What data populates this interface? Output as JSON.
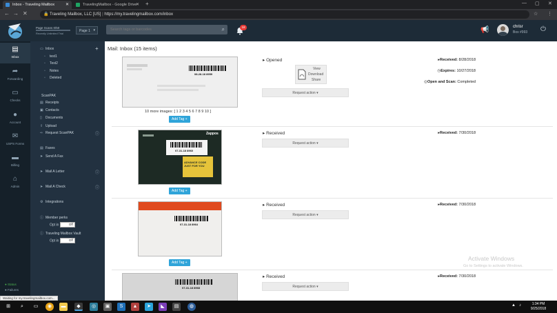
{
  "browser": {
    "tabs": [
      {
        "title": "Inbox - Traveling Mailbox",
        "color": "#3b8bd6"
      },
      {
        "title": "TravelingMailbox - Google Drive",
        "color": "#1ea362"
      }
    ],
    "url_owner": "Traveling Mailbox, LLC [US]",
    "url": "https://my.travelingmailbox.com/inbox",
    "status_bar": "Waiting for my.travelingmailbox.com..."
  },
  "header": {
    "scans_label": "Page Scans",
    "scans_value": "0/50",
    "plan_label": "Recently Unlimited Trial",
    "page_select": "Page 1",
    "search_placeholder": "Search tags or barcodes",
    "notification_count": "18",
    "user_name": "chrisr",
    "user_box": "Box #993"
  },
  "leftnav": [
    {
      "label": "Inbox",
      "icon": "inbox-icon",
      "glyph": "▤"
    },
    {
      "label": "Forwarding",
      "icon": "forward-icon",
      "glyph": "➦"
    },
    {
      "label": "Checks",
      "icon": "check-icon",
      "glyph": "▭"
    },
    {
      "label": "Account",
      "icon": "user-icon",
      "glyph": "●"
    },
    {
      "label": "USPS Forms",
      "icon": "form-icon",
      "glyph": "✉"
    },
    {
      "label": "Billing",
      "icon": "billing-icon",
      "glyph": "▬"
    },
    {
      "label": "Admin",
      "icon": "admin-icon",
      "glyph": "⌂"
    }
  ],
  "leftnav_footer": {
    "status1": "Status",
    "status2": "Failures"
  },
  "subnav": {
    "inbox": "Inbox",
    "folders": [
      "test1",
      "Test2",
      "Notes",
      "Deleted"
    ],
    "scanpak_header": "ScanPAK",
    "scanpak_items": [
      "Receipts",
      "Contacts",
      "Documents",
      "Upload",
      "Request ScanPAK"
    ],
    "faxes": "Faxes",
    "send_fax": "Send A Fax",
    "mail_letter": "Mail A Letter",
    "mail_check": "Mail A Check",
    "integrations": "Integrations",
    "member_perks": "Member perks",
    "opt_in_1": "Opt in",
    "off_1": "Off",
    "vault": "Traveling Mailbox Vault",
    "opt_in_2": "Opt in",
    "off_2": "Off"
  },
  "mail": {
    "title": "Mail: Inbox (15 items)",
    "request_action": "Request action",
    "add_tag": "Add Tag",
    "items": [
      {
        "status": "Opened",
        "barcode": "08-28-18 8959",
        "more_images": "10 more images: [ 1 2 3 4 5 6 7 8 9 10 ]",
        "pdf_actions": [
          "View",
          "Download",
          "Share"
        ],
        "received_label": "Received:",
        "received": "8/28/2018",
        "expires_label": "Expires:",
        "expires": "10/27/2018",
        "scan_label": "Open and Scan:",
        "scan_status": "Completed"
      },
      {
        "status": "Received",
        "barcode": "07-31-18 8960",
        "stamp": "Zappos",
        "promo": "ADVANCE CODE JUST FOR YOU",
        "received_label": "Received:",
        "received": "7/30/2018"
      },
      {
        "status": "Received",
        "barcode": "07-31-18 8964",
        "received_label": "Received:",
        "received": "7/30/2018"
      },
      {
        "status": "Received",
        "barcode": "07-31-18 8968",
        "received_label": "Received:",
        "received": "7/30/2018"
      }
    ]
  },
  "watermark": {
    "line1": "Activate Windows",
    "line2": "Go to Settings to activate Windows."
  },
  "taskbar": {
    "time": "1:34 PM",
    "date": "9/25/2018"
  },
  "colors": {
    "accent": "#2fa4d9",
    "header": "#1d2b37",
    "sidebar": "#223140",
    "badge": "#e53935"
  }
}
